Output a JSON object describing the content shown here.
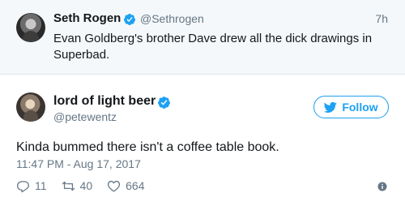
{
  "quoted_tweet": {
    "name": "Seth Rogen",
    "handle": "@Sethrogen",
    "time": "7h",
    "text": "Evan Goldberg's brother Dave drew all the dick drawings in Superbad."
  },
  "tweet": {
    "name": "lord of light beer",
    "handle": "@petewentz",
    "text": "Kinda bummed there isn't a coffee table book.",
    "timestamp": "11:47 PM - Aug 17, 2017",
    "replies": "11",
    "retweets": "40",
    "likes": "664"
  },
  "follow_button": {
    "label": "Follow"
  },
  "colors": {
    "accent": "#1da1f2",
    "verified": "#1da1f2",
    "secondary_text": "#657786",
    "primary_text": "#14171a",
    "quote_background": "#f5f8fa"
  },
  "icons": {
    "verified": "verified-badge-icon",
    "follow": "twitter-bird-icon",
    "reply": "reply-icon",
    "retweet": "retweet-icon",
    "like": "heart-icon",
    "info": "info-icon"
  }
}
